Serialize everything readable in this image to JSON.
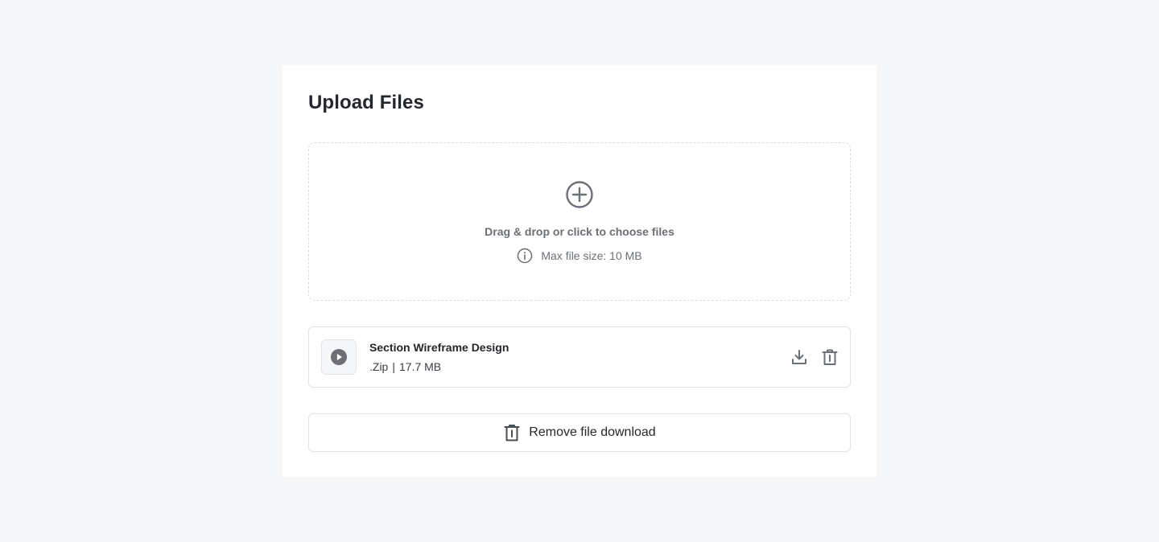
{
  "card": {
    "title": "Upload Files"
  },
  "dropzone": {
    "icon": "plus-circle-icon",
    "instruction": "Drag & drop or click to choose files",
    "hint_icon": "info-icon",
    "hint": "Max file size: 10 MB"
  },
  "files": [
    {
      "thumb_icon": "play-circle-icon",
      "name": "Section Wireframe Design",
      "extension": ".Zip",
      "separator": "|",
      "size": "17.7 MB",
      "actions": [
        "download-icon",
        "trash-icon"
      ]
    }
  ],
  "remove_button": {
    "icon": "trash-icon",
    "label": "Remove file download"
  },
  "colors": {
    "background": "#f6f7f9",
    "card": "#ffffff",
    "border": "#e2e4e8",
    "icon": "#6b6f76",
    "text": "#24272b"
  }
}
